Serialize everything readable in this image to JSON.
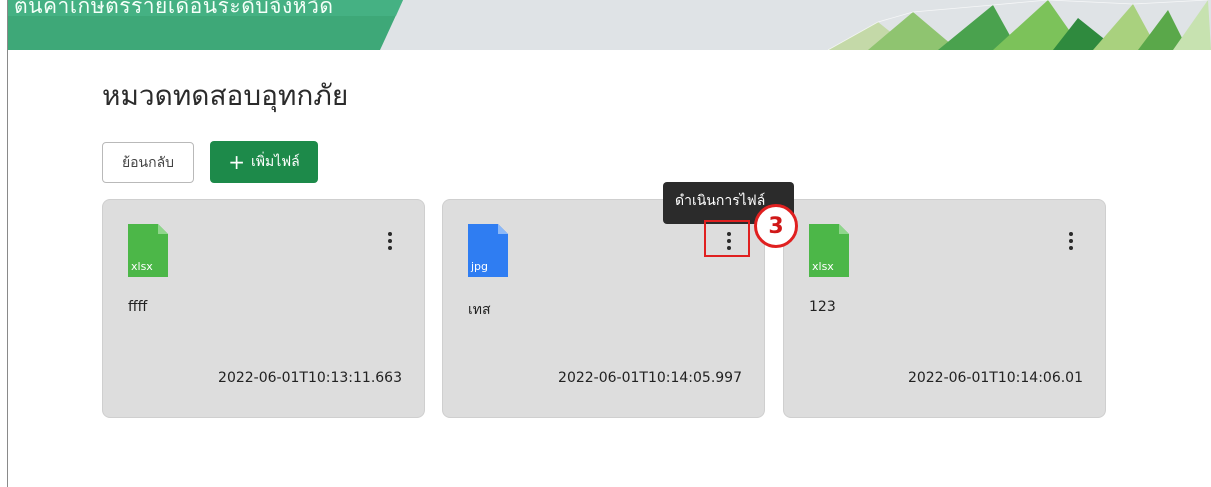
{
  "header": {
    "banner_title": "ต้นค่าเกษตรรายเดือนระดับจังหวัด"
  },
  "page": {
    "title": "หมวดทดสอบอุทกภัย"
  },
  "toolbar": {
    "back_label": "ย้อนกลับ",
    "add_label": "เพิ่มไฟล์",
    "add_icon": "+"
  },
  "files": [
    {
      "icon": "xlsx-file-icon",
      "ext": "xlsx",
      "name": "ffff",
      "date": "2022-06-01T10:13:11.663",
      "color": "#4cb748"
    },
    {
      "icon": "jpg-file-icon",
      "ext": "jpg",
      "name": "เทส",
      "date": "2022-06-01T10:14:05.997",
      "color": "#2f7df2"
    },
    {
      "icon": "xlsx-file-icon",
      "ext": "xlsx",
      "name": "123",
      "date": "2022-06-01T10:14:06.01",
      "color": "#4cb748"
    }
  ],
  "tooltip": {
    "text": "ดำเนินการไฟล์"
  },
  "annotation": {
    "step_number": "3",
    "color": "#e02020"
  },
  "colors": {
    "brand_green": "#1d8a4a",
    "card_bg": "#dddddd"
  }
}
